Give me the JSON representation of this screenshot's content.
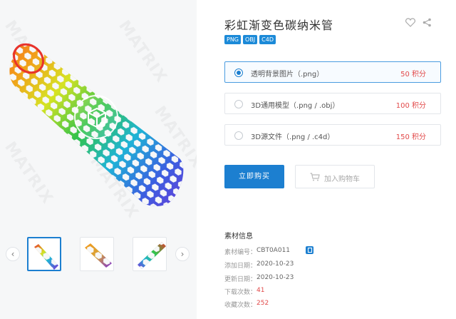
{
  "product": {
    "title": "彩虹渐变色碳纳米管",
    "formats": [
      "PNG",
      "OBJ",
      "C4D"
    ]
  },
  "preview": {
    "watermark_text": "MATRIX",
    "thumbnails_count": 3,
    "active_thumbnail": 1
  },
  "options": [
    {
      "label": "透明背景图片（.png）",
      "price": "50 积分",
      "selected": true
    },
    {
      "label": "3D通用模型（.png / .obj）",
      "price": "100 积分",
      "selected": false
    },
    {
      "label": "3D源文件（.png / .c4d）",
      "price": "150 积分",
      "selected": false
    }
  ],
  "actions": {
    "buy_label": "立即购买",
    "cart_label": "加入购物车"
  },
  "info": {
    "heading": "素材信息",
    "rows": [
      {
        "key": "素材编号：",
        "value": "CBT0A011",
        "highlight": false
      },
      {
        "key": "添加日期：",
        "value": "2020-10-23",
        "highlight": false
      },
      {
        "key": "更新日期：",
        "value": "2020-10-23",
        "highlight": false
      },
      {
        "key": "下载次数：",
        "value": "41",
        "highlight": true
      },
      {
        "key": "收藏次数：",
        "value": "252",
        "highlight": true
      }
    ]
  },
  "colors": {
    "accent": "#1c7fd0",
    "tag": "#1c8ad8",
    "price": "#e24a4a"
  },
  "icons": {
    "favorite": "heart-icon",
    "share": "share-icon",
    "viewer": "3d-cube-icon",
    "cart": "cart-icon",
    "copy": "copy-icon",
    "prev": "chevron-left-icon",
    "next": "chevron-right-icon"
  }
}
